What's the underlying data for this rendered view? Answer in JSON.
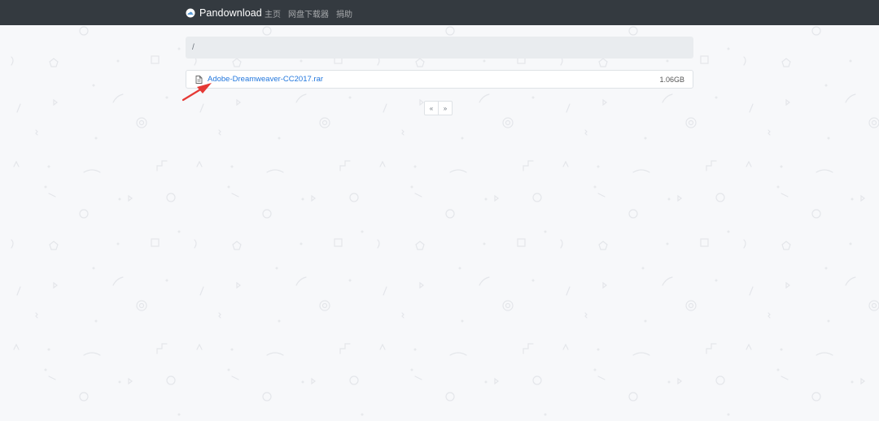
{
  "navbar": {
    "brand": "Pandownload",
    "brand_icon": "cloud-icon",
    "links": [
      "主页",
      "网盘下载器",
      "捐助"
    ]
  },
  "breadcrumb": {
    "path": "/"
  },
  "files": [
    {
      "name": "Adobe-Dreamweaver-CC2017.rar",
      "size": "1.06GB",
      "icon": "file-icon"
    }
  ],
  "pagination": {
    "prev": "«",
    "next": "»"
  },
  "colors": {
    "navbar_bg": "#343a40",
    "link": "#2277dd",
    "breadcrumb_bg": "#e9ecef",
    "annotation": "#e53935"
  }
}
